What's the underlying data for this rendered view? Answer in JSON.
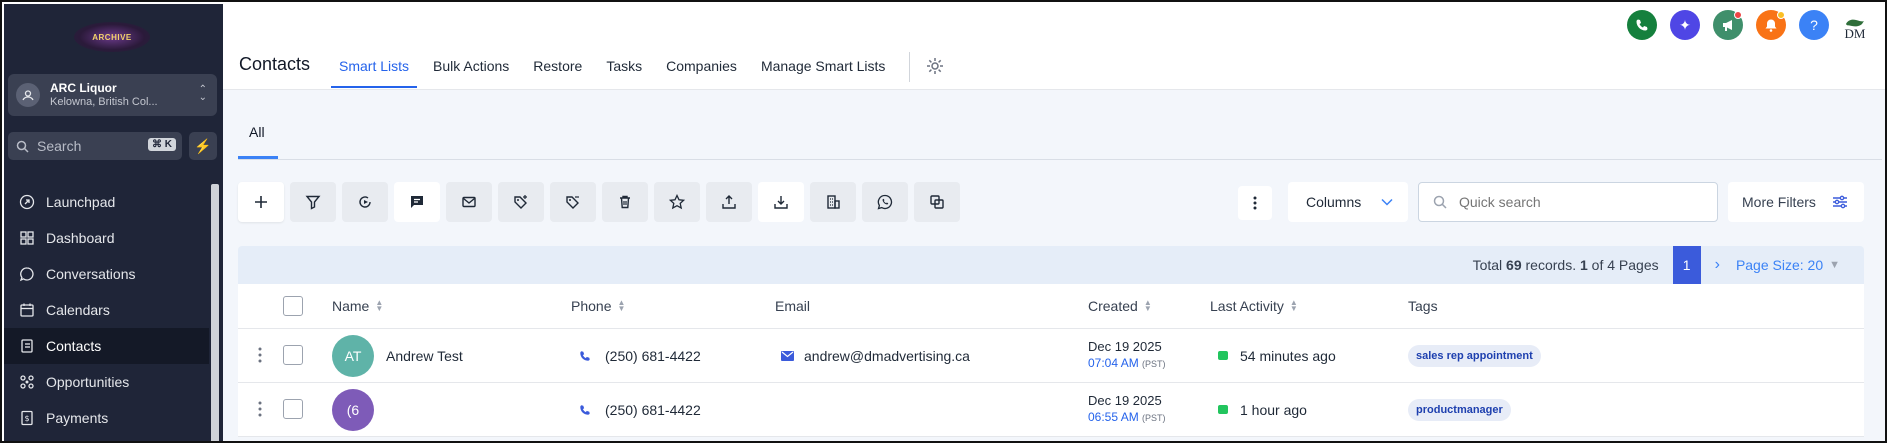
{
  "sidebar": {
    "logo_text": "ARCHIVE",
    "account": {
      "name": "ARC Liquor",
      "location": "Kelowna, British Col..."
    },
    "search": {
      "placeholder": "Search",
      "shortcut": "⌘ K"
    },
    "items": [
      {
        "label": "Launchpad",
        "icon": "rocket-icon"
      },
      {
        "label": "Dashboard",
        "icon": "dashboard-icon"
      },
      {
        "label": "Conversations",
        "icon": "chat-icon"
      },
      {
        "label": "Calendars",
        "icon": "calendar-icon"
      },
      {
        "label": "Contacts",
        "icon": "contacts-icon",
        "active": true
      },
      {
        "label": "Opportunities",
        "icon": "opportunities-icon"
      },
      {
        "label": "Payments",
        "icon": "payments-icon"
      }
    ]
  },
  "header": {
    "title": "Contacts",
    "tabs": [
      "Smart Lists",
      "Bulk Actions",
      "Restore",
      "Tasks",
      "Companies",
      "Manage Smart Lists"
    ],
    "active_tab": "Smart Lists",
    "brand_initials": "DM",
    "icon_colors": {
      "phone": "#15803d",
      "ai": "#4f46e5",
      "announce": "#3f8f6b",
      "bell": "#f97316",
      "help": "#3b82f6"
    }
  },
  "subtabs": [
    "All"
  ],
  "toolbar": {
    "columns_label": "Columns",
    "search_placeholder": "Quick search",
    "more_filters_label": "More Filters"
  },
  "pager": {
    "total_prefix": "Total",
    "total_records": "69",
    "records_mid": "records.",
    "page": "1",
    "of_text": "of 4 Pages",
    "current_page": "1",
    "page_size": "Page Size: 20"
  },
  "table": {
    "headers": {
      "name": "Name",
      "phone": "Phone",
      "email": "Email",
      "created": "Created",
      "last_activity": "Last Activity",
      "tags": "Tags"
    },
    "rows": [
      {
        "initials": "AT",
        "avatar_color": "#5fb3a8",
        "name": "Andrew Test",
        "phone": "(250) 681-4422",
        "email": "andrew@dmadvertising.ca",
        "created_date": "Dec 19 2025",
        "created_time": "07:04 AM",
        "tz": "(PST)",
        "last_activity": "54 minutes ago",
        "tag": "sales rep appointment"
      },
      {
        "initials": "(6",
        "avatar_color": "#7e5bb8",
        "name": "",
        "phone": "(250) 681-4422",
        "email": "",
        "created_date": "Dec 19 2025",
        "created_time": "06:55 AM",
        "tz": "(PST)",
        "last_activity": "1 hour ago",
        "tag": "productmanager"
      }
    ]
  }
}
